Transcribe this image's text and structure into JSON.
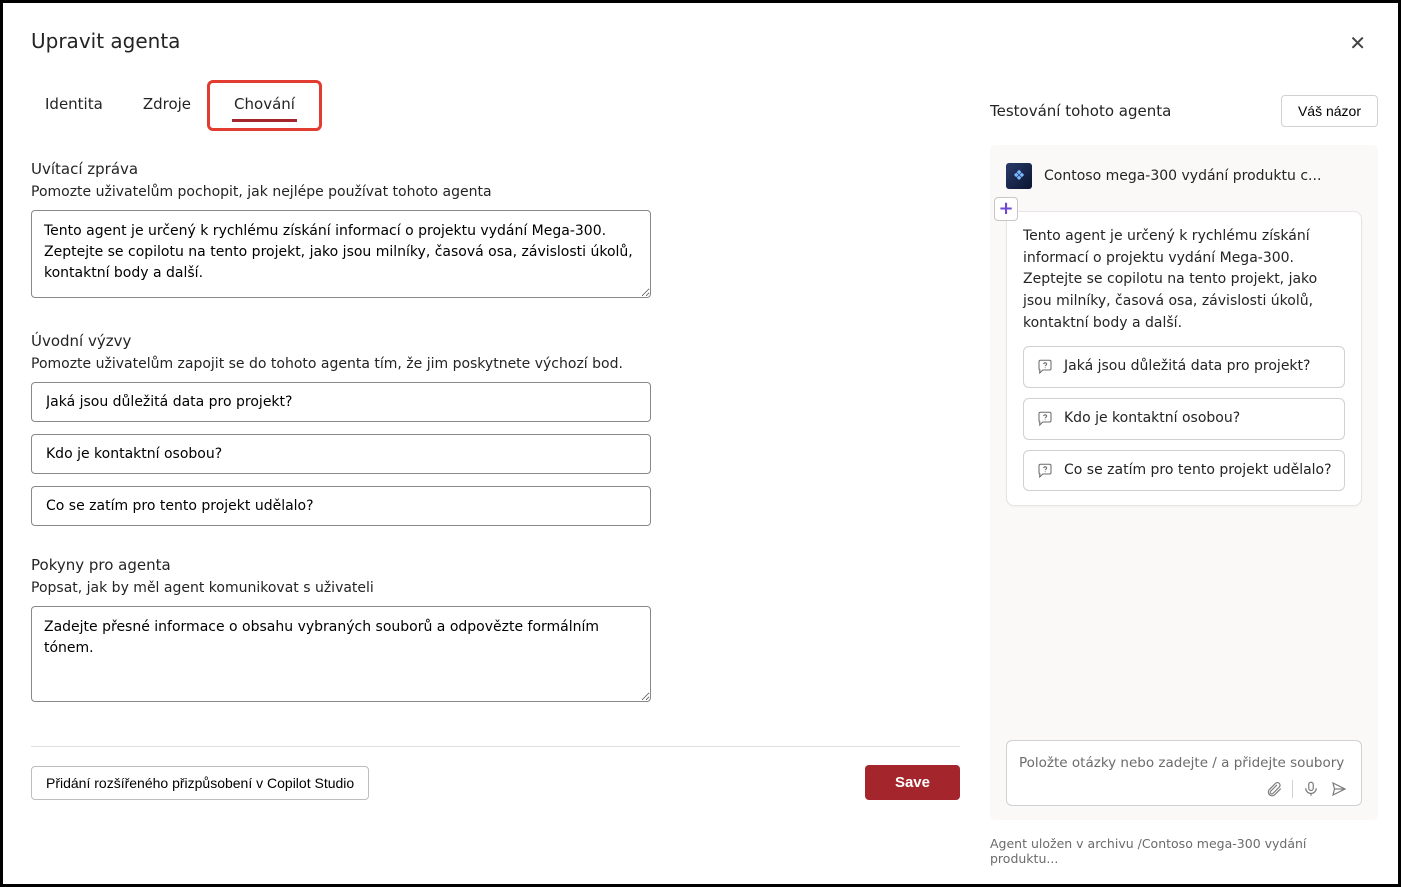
{
  "header": {
    "title": "Upravit agenta"
  },
  "tabs": [
    {
      "label": "Identita",
      "active": false
    },
    {
      "label": "Zdroje",
      "active": false
    },
    {
      "label": "Chování",
      "active": true
    }
  ],
  "welcome": {
    "heading": "Uvítací zpráva",
    "subtext": "Pomozte uživatelům pochopit, jak nejlépe používat tohoto agenta",
    "value": "Tento agent je určený k rychlému získání informací o projektu vydání Mega-300. Zeptejte se copilotu na tento projekt, jako jsou milníky, časová osa, závislosti úkolů, kontaktní body a další."
  },
  "starter": {
    "heading": "Úvodní výzvy",
    "subtext": "Pomozte uživatelům zapojit se do tohoto agenta tím, že jim poskytnete výchozí bod.",
    "prompts": [
      "Jaká jsou důležitá data pro projekt?",
      "Kdo je kontaktní osobou?",
      "Co se zatím pro tento projekt udělalo?"
    ]
  },
  "instructions": {
    "heading": "Pokyny pro agenta",
    "subtext": "Popsat, jak by měl agent komunikovat s uživateli",
    "value": "Zadejte přesné informace o obsahu vybraných souborů a odpovězte formálním tónem."
  },
  "footer": {
    "extend_label": "Přidání rozšířeného přizpůsobení v Copilot Studio",
    "save_label": "Save"
  },
  "test": {
    "title": "Testování tohoto agenta",
    "feedback_label": "Váš názor",
    "agent_name": "Contoso mega-300 vydání produktu c...",
    "welcome_bubble": "Tento agent je určený k rychlému získání informací o projektu vydání Mega-300. Zeptejte se copilotu na tento projekt, jako jsou milníky, časová osa, závislosti úkolů, kontaktní body a další.",
    "suggestions": [
      "Jaká jsou důležitá data pro projekt?",
      "Kdo je kontaktní osobou?",
      "Co se zatím pro tento projekt udělalo?"
    ],
    "input_placeholder": "Položte otázky nebo zadejte / a přidejte soubory nebo lidi.",
    "saved_note": "Agent uložen v archivu /Contoso mega-300 vydání produktu..."
  }
}
